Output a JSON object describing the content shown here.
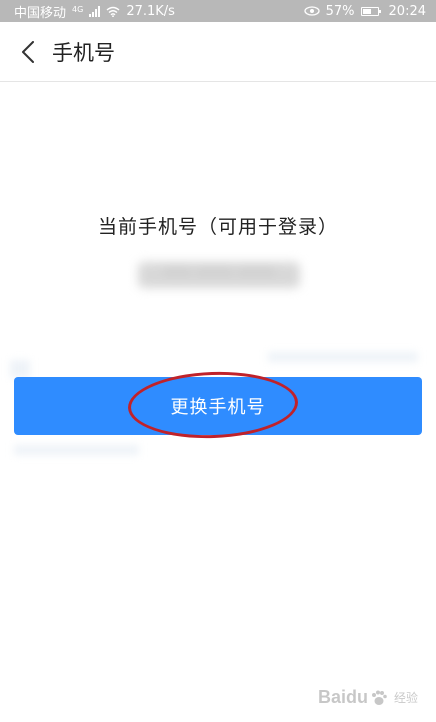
{
  "status_bar": {
    "carrier": "中国移动",
    "network_type": "4G",
    "speed": "27.1K/s",
    "battery": "57%",
    "time": "20:24",
    "icons": [
      "signal-icon",
      "wifi-icon",
      "eye-icon",
      "battery-icon"
    ]
  },
  "nav": {
    "back_icon": "chevron-left-icon",
    "title": "手机号"
  },
  "content": {
    "label": "当前手机号（可用于登录）",
    "phone_masked": "*** **** ****"
  },
  "action": {
    "change_phone_label": "更换手机号",
    "color": "#2f8cff"
  },
  "annotation": {
    "color": "#c0222a"
  },
  "watermark": {
    "brand": "Baidu",
    "suffix": "经验"
  }
}
